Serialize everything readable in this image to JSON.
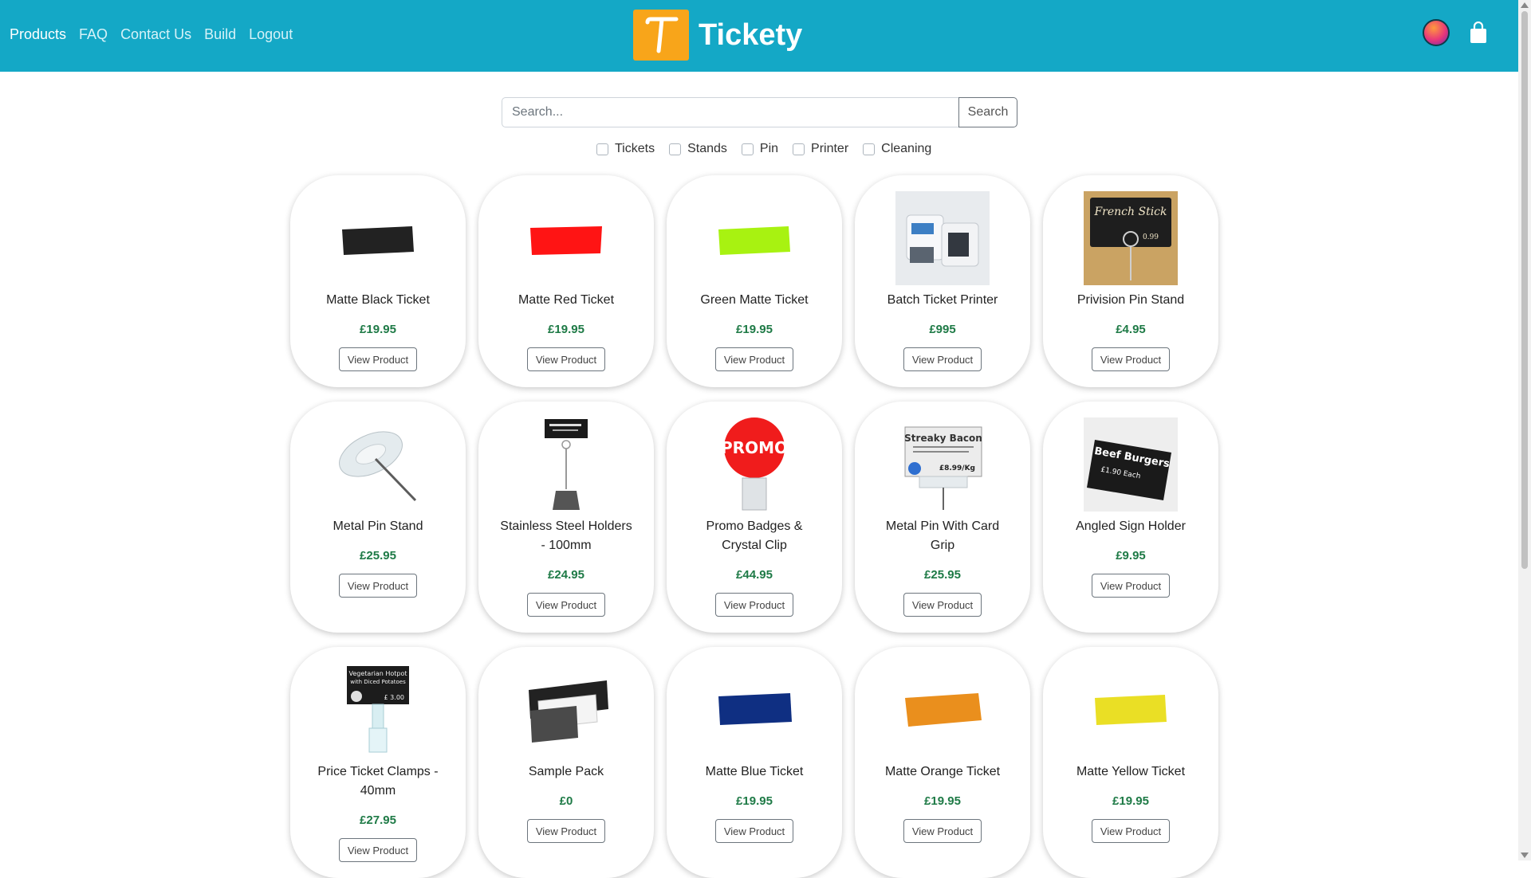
{
  "nav": {
    "links": [
      "Products",
      "FAQ",
      "Contact Us",
      "Build",
      "Logout"
    ],
    "brand_letter": "T",
    "brand_name": "Tickety",
    "icons": [
      "avatar",
      "shopping-bag-icon"
    ]
  },
  "search": {
    "placeholder": "Search...",
    "button_label": "Search",
    "value": ""
  },
  "filters": [
    "Tickets",
    "Stands",
    "Pin",
    "Printer",
    "Cleaning"
  ],
  "products": [
    {
      "name": "Matte Black Ticket",
      "price": "£19.95",
      "button": "View Product",
      "image": "black-ticket"
    },
    {
      "name": "Matte Red Ticket",
      "price": "£19.95",
      "button": "View Product",
      "image": "red-ticket"
    },
    {
      "name": "Green Matte Ticket",
      "price": "£19.95",
      "button": "View Product",
      "image": "green-ticket"
    },
    {
      "name": "Batch Ticket Printer",
      "price": "£995",
      "button": "View Product",
      "image": "ticket-printer"
    },
    {
      "name": "Privision Pin Stand",
      "price": "£4.95",
      "button": "View Product",
      "image": "french-stick-pin-stand"
    },
    {
      "name": "Metal Pin Stand",
      "price": "£25.95",
      "button": "View Product",
      "image": "metal-pin-stand"
    },
    {
      "name": "Stainless Steel Holders - 100mm",
      "price": "£24.95",
      "button": "View Product",
      "image": "steel-holder"
    },
    {
      "name": "Promo Badges & Crystal Clip",
      "price": "£44.95",
      "button": "View Product",
      "image": "promo-badge"
    },
    {
      "name": "Metal Pin With Card Grip",
      "price": "£25.95",
      "button": "View Product",
      "image": "streaky-bacon-card-grip"
    },
    {
      "name": "Angled Sign Holder",
      "price": "£9.95",
      "button": "View Product",
      "image": "beef-burgers-sign"
    },
    {
      "name": "Price Ticket Clamps - 40mm",
      "price": "£27.95",
      "button": "View Product",
      "image": "vegetarian-hotpot-clamp"
    },
    {
      "name": "Sample Pack",
      "price": "£0",
      "button": "View Product",
      "image": "sample-pack"
    },
    {
      "name": "Matte Blue Ticket",
      "price": "£19.95",
      "button": "View Product",
      "image": "blue-ticket"
    },
    {
      "name": "Matte Orange Ticket",
      "price": "£19.95",
      "button": "View Product",
      "image": "orange-ticket"
    },
    {
      "name": "Matte Yellow Ticket",
      "price": "£19.95",
      "button": "View Product",
      "image": "yellow-ticket"
    }
  ],
  "image_text": {
    "promo": "PROMO",
    "french_stick": "French Stick",
    "french_stick_price": "0.99",
    "streaky_bacon": "Streaky Bacon",
    "streaky_price": "£8.99/Kg",
    "beef_burgers": "Beef Burgers",
    "beef_each": "£1.90 Each",
    "veg_hotpot": "Vegetarian Hotpot",
    "veg_sub": "with Diced Potatoes",
    "veg_price": "£ 3.00"
  },
  "colors": {
    "navbar": "#14a8c6",
    "brand_logo": "#f8a51a",
    "price": "#1e7a46",
    "black_ticket": "#222222",
    "red_ticket": "#ff1414",
    "green_ticket": "#a8f211",
    "blue_ticket": "#0f2f82",
    "orange_ticket": "#ea8f1d",
    "yellow_ticket": "#eadf25",
    "promo_red": "#f01c1c"
  }
}
